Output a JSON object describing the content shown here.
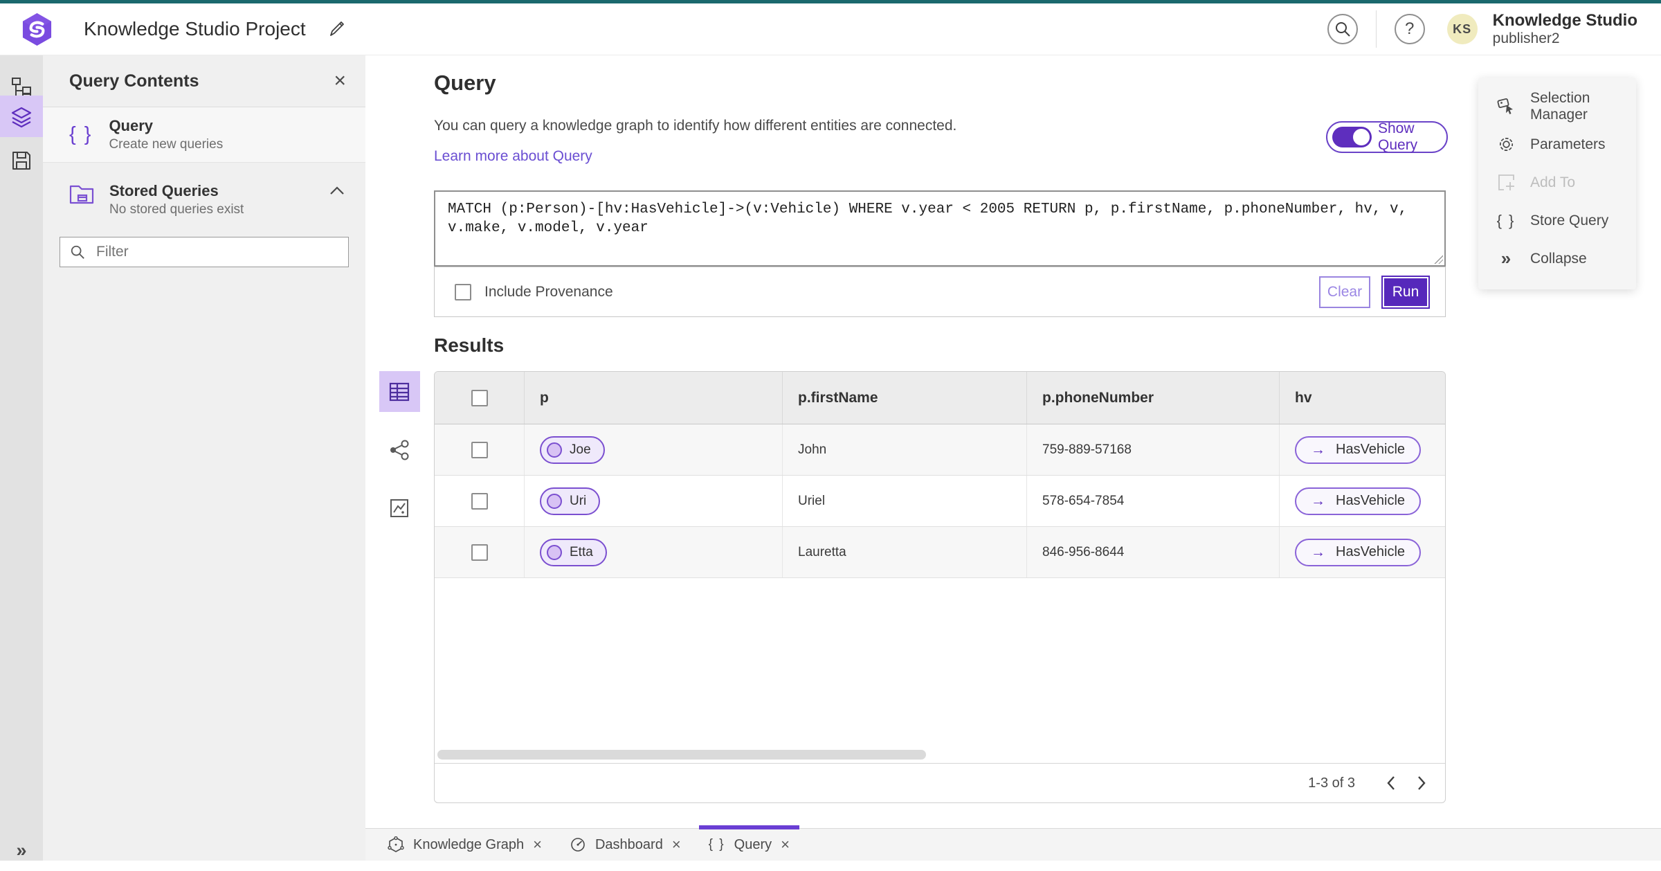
{
  "app": {
    "title": "Knowledge Studio Project",
    "user_initials": "KS",
    "user_org": "Knowledge Studio",
    "user_name": "publisher2"
  },
  "glyphs": {
    "close": "×",
    "braces": "{ }",
    "question": "?",
    "arrow_right": "→",
    "chevrons_right": "»"
  },
  "left_panel": {
    "title": "Query Contents",
    "query_item": {
      "title": "Query",
      "subtitle": "Create new queries"
    },
    "stored": {
      "title": "Stored Queries",
      "subtitle": "No stored queries exist"
    },
    "filter_placeholder": "Filter"
  },
  "query_section": {
    "title": "Query",
    "description": "You can query a knowledge graph to identify how different entities are connected.",
    "learn_more": "Learn more about Query",
    "show_query_label": "Show Query",
    "query_text": "MATCH (p:Person)-[hv:HasVehicle]->(v:Vehicle) WHERE v.year < 2005 RETURN p, p.firstName, p.phoneNumber, hv, v, v.make, v.model, v.year",
    "include_provenance_label": "Include Provenance",
    "clear_label": "Clear",
    "run_label": "Run"
  },
  "results": {
    "title": "Results",
    "columns": [
      "p",
      "p.firstName",
      "p.phoneNumber",
      "hv"
    ],
    "rows": [
      {
        "p": "Joe",
        "firstName": "John",
        "phoneNumber": "759-889-57168",
        "hv": "HasVehicle"
      },
      {
        "p": "Uri",
        "firstName": "Uriel",
        "phoneNumber": "578-654-7854",
        "hv": "HasVehicle"
      },
      {
        "p": "Etta",
        "firstName": "Lauretta",
        "phoneNumber": "846-956-8644",
        "hv": "HasVehicle"
      }
    ],
    "pagination": {
      "label": "1-3 of 3"
    }
  },
  "context_menu": {
    "items": [
      {
        "label": "Selection Manager",
        "disabled": false
      },
      {
        "label": "Parameters",
        "disabled": false
      },
      {
        "label": "Add To",
        "disabled": true
      },
      {
        "label": "Store Query",
        "disabled": false
      },
      {
        "label": "Collapse",
        "disabled": false
      }
    ]
  },
  "tabs": [
    {
      "label": "Knowledge Graph"
    },
    {
      "label": "Dashboard"
    },
    {
      "label": "Query"
    }
  ],
  "colors": {
    "top_strip": "#1b696d",
    "accent_purple": "#5e2ebe",
    "accent_purple_mid": "#7b4fd0",
    "accent_purple_light": "#d8c7f6",
    "pill_bg": "#efe9fb",
    "link": "#6a4ed2",
    "avatar_bg": "#f0ebbe",
    "panel_bg": "#f0f0f0",
    "rail_bg": "#e2e2e2",
    "table_header_bg": "#ececec",
    "zebra_row_bg": "#f7f7f7"
  }
}
